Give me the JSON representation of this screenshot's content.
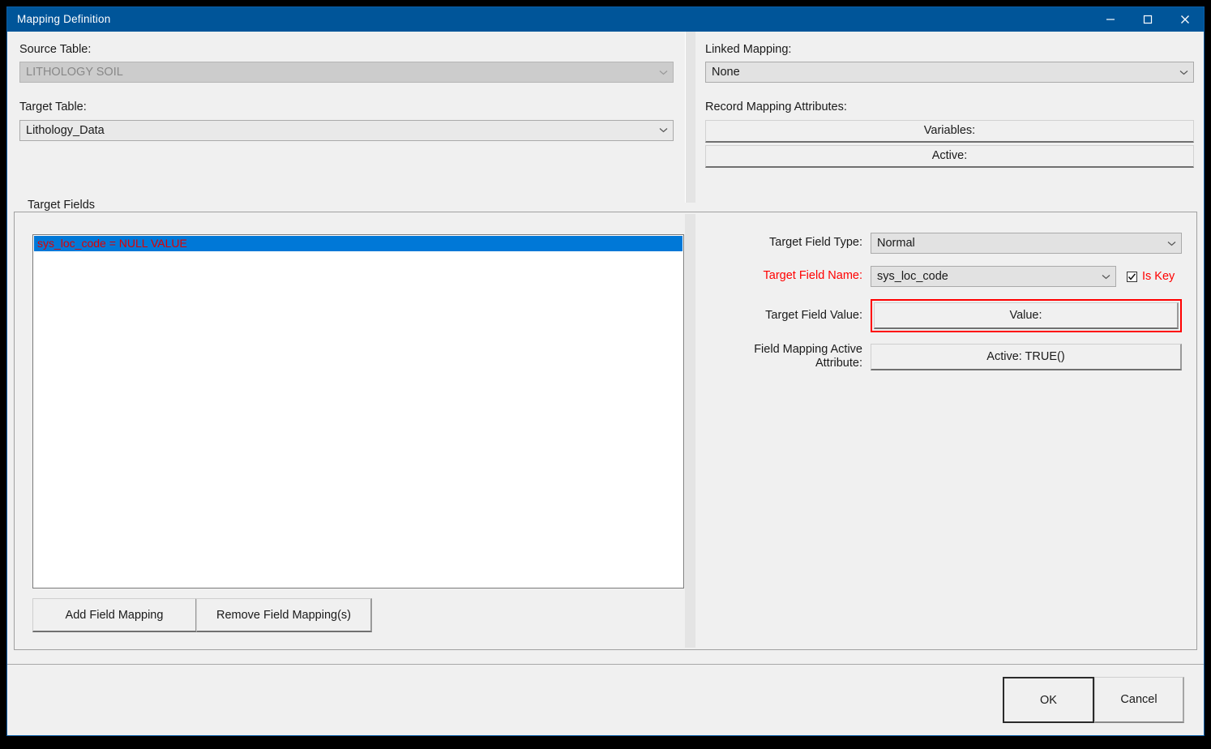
{
  "window": {
    "title": "Mapping Definition",
    "controls": {
      "minimize": "minimize-icon",
      "maximize": "maximize-icon",
      "close": "close-icon"
    },
    "accent_color": "#005599"
  },
  "top": {
    "source_table": {
      "label": "Source Table:",
      "value": "LITHOLOGY SOIL",
      "disabled": true
    },
    "target_table": {
      "label": "Target Table:",
      "value": "Lithology_Data"
    },
    "linked_mapping": {
      "label": "Linked Mapping:",
      "value": "None"
    },
    "record_mapping_attributes": {
      "label": "Record Mapping Attributes:",
      "variables_label": "Variables:",
      "active_label": "Active:"
    }
  },
  "target_fields": {
    "group_title": "Target Fields",
    "list": [
      {
        "text": "sys_loc_code = NULL VALUE",
        "selected": true
      }
    ],
    "list_text_color": "#e00000",
    "list_selection_color": "#0078d7",
    "buttons": {
      "add": "Add Field Mapping",
      "remove": "Remove Field Mapping(s)"
    },
    "properties": {
      "target_field_type": {
        "label": "Target Field Type:",
        "value": "Normal"
      },
      "target_field_name": {
        "label": "Target Field Name:",
        "label_color": "#ff0000",
        "value": "sys_loc_code"
      },
      "is_key": {
        "label": "Is Key",
        "label_color": "#ff0000",
        "checked": true
      },
      "target_field_value": {
        "label": "Target Field Value:",
        "value": "Value:",
        "highlight_color": "#ff0000"
      },
      "field_mapping_active_attribute": {
        "label_line1": "Field Mapping Active",
        "label_line2": "Attribute:",
        "value": "Active: TRUE()"
      }
    }
  },
  "footer": {
    "ok": "OK",
    "cancel": "Cancel"
  }
}
